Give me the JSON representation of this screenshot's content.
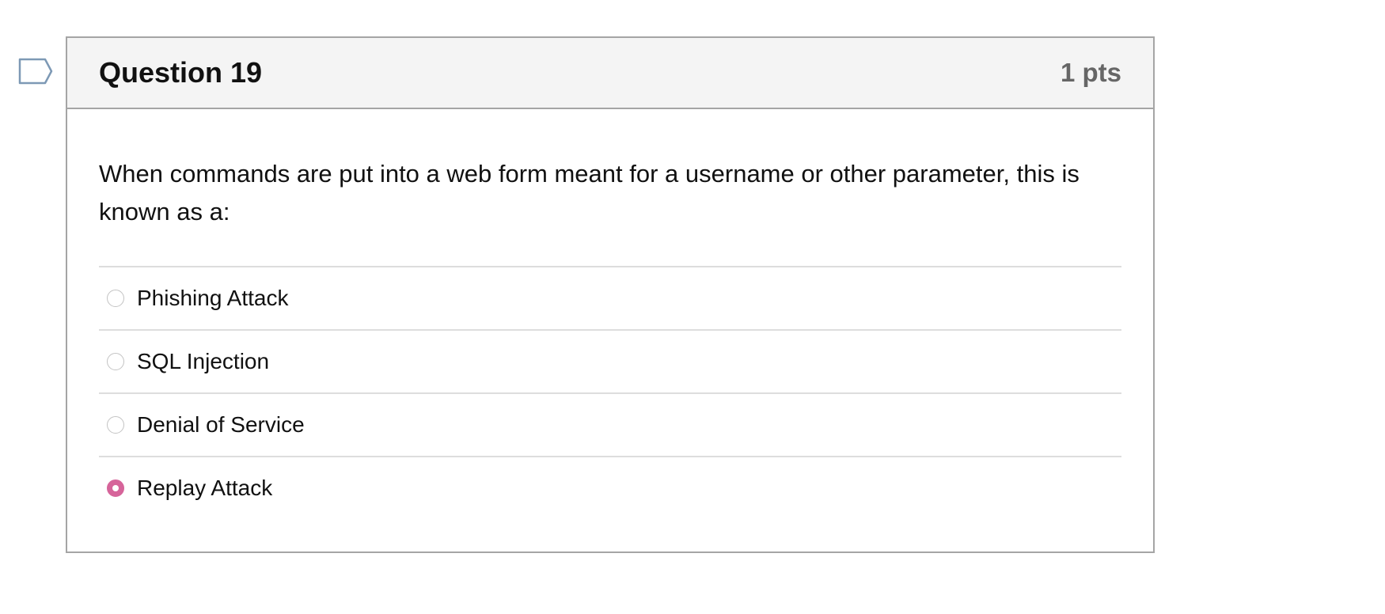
{
  "question": {
    "title": "Question 19",
    "points": "1 pts",
    "text": "When commands are put into a web form meant for a username or other parameter, this is known as a:",
    "answers": [
      {
        "label": "Phishing Attack",
        "selected": false
      },
      {
        "label": "SQL Injection",
        "selected": false
      },
      {
        "label": "Denial of Service",
        "selected": false
      },
      {
        "label": "Replay Attack",
        "selected": true
      }
    ]
  },
  "colors": {
    "accent": "#d6649a",
    "flag_outline": "#7d99b5",
    "header_bg": "#f4f4f4",
    "border": "#a5a5a5"
  },
  "icons": {
    "flag": "flag-question-icon",
    "radio": "radio-button-icon"
  }
}
